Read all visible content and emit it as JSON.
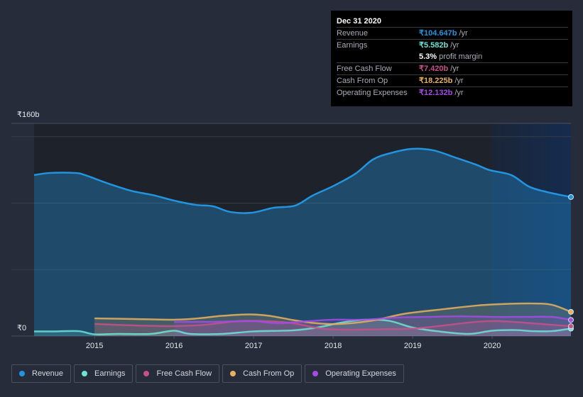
{
  "tooltip": {
    "date": "Dec 31 2020",
    "rows": [
      {
        "label": "Revenue",
        "value": "₹104.647b",
        "unit": "/yr",
        "color": "#2394df"
      },
      {
        "label": "Earnings",
        "value": "₹5.582b",
        "unit": "/yr",
        "color": "#6ce5d5"
      },
      {
        "label": "",
        "value": "5.3%",
        "unit": "profit margin",
        "color": "#ffffff"
      },
      {
        "label": "Free Cash Flow",
        "value": "₹7.420b",
        "unit": "/yr",
        "color": "#c8508a"
      },
      {
        "label": "Cash From Op",
        "value": "₹18.225b",
        "unit": "/yr",
        "color": "#e9b15e"
      },
      {
        "label": "Operating Expenses",
        "value": "₹12.132b",
        "unit": "/yr",
        "color": "#a54be6"
      }
    ]
  },
  "legend": [
    {
      "label": "Revenue",
      "color": "#2394df"
    },
    {
      "label": "Earnings",
      "color": "#6ce5d5"
    },
    {
      "label": "Free Cash Flow",
      "color": "#c8508a"
    },
    {
      "label": "Cash From Op",
      "color": "#e9b15e"
    },
    {
      "label": "Operating Expenses",
      "color": "#a54be6"
    }
  ],
  "chart_data": {
    "type": "area",
    "title": "",
    "xlabel": "",
    "ylabel": "",
    "currency": "₹",
    "y_tick_labels": [
      "₹0",
      "₹160b"
    ],
    "ylim": [
      0,
      160
    ],
    "y_unit": "billions INR",
    "xlim": [
      2014.24,
      2020.99
    ],
    "x_tick_labels": [
      "2015",
      "2016",
      "2017",
      "2018",
      "2019",
      "2020"
    ],
    "x_ticks": [
      2015,
      2016,
      2017,
      2018,
      2019,
      2020
    ],
    "gridlines": [
      50,
      100,
      150
    ],
    "highlight_region_from": 2020.0,
    "series": [
      {
        "name": "Revenue",
        "color": "#2394df",
        "filled": true,
        "points": [
          [
            2014.24,
            121.1
          ],
          [
            2014.44,
            122.7
          ],
          [
            2014.75,
            122.7
          ],
          [
            2014.88,
            121.1
          ],
          [
            2015.15,
            115.2
          ],
          [
            2015.46,
            109.3
          ],
          [
            2015.73,
            106.1
          ],
          [
            2016.0,
            101.9
          ],
          [
            2016.27,
            98.7
          ],
          [
            2016.49,
            97.6
          ],
          [
            2016.71,
            93.3
          ],
          [
            2016.98,
            92.8
          ],
          [
            2017.25,
            96.5
          ],
          [
            2017.52,
            98.1
          ],
          [
            2017.74,
            105.6
          ],
          [
            2018.01,
            113.1
          ],
          [
            2018.28,
            122.1
          ],
          [
            2018.5,
            132.8
          ],
          [
            2018.72,
            137.6
          ],
          [
            2018.99,
            140.8
          ],
          [
            2019.26,
            139.7
          ],
          [
            2019.53,
            134.4
          ],
          [
            2019.79,
            129.1
          ],
          [
            2019.97,
            124.8
          ],
          [
            2020.24,
            121.1
          ],
          [
            2020.46,
            112.5
          ],
          [
            2020.69,
            108.3
          ],
          [
            2020.99,
            104.6
          ]
        ]
      },
      {
        "name": "Earnings",
        "color": "#6ce5d5",
        "filled": true,
        "points": [
          [
            2014.24,
            3.5
          ],
          [
            2014.5,
            3.5
          ],
          [
            2014.8,
            3.7
          ],
          [
            2015.0,
            1.3
          ],
          [
            2015.3,
            1.6
          ],
          [
            2015.7,
            1.6
          ],
          [
            2016.0,
            4.0
          ],
          [
            2016.2,
            1.6
          ],
          [
            2016.6,
            1.6
          ],
          [
            2017.0,
            3.5
          ],
          [
            2017.5,
            4.3
          ],
          [
            2017.8,
            6.4
          ],
          [
            2018.1,
            10.1
          ],
          [
            2018.4,
            12.3
          ],
          [
            2018.7,
            11.5
          ],
          [
            2019.0,
            6.4
          ],
          [
            2019.3,
            3.7
          ],
          [
            2019.7,
            1.6
          ],
          [
            2020.0,
            4.0
          ],
          [
            2020.3,
            4.5
          ],
          [
            2020.5,
            3.7
          ],
          [
            2020.75,
            3.7
          ],
          [
            2020.99,
            5.6
          ]
        ]
      },
      {
        "name": "Free Cash Flow",
        "color": "#c8508a",
        "filled": true,
        "points": [
          [
            2015.0,
            9.1
          ],
          [
            2015.5,
            8.0
          ],
          [
            2016.0,
            7.5
          ],
          [
            2016.4,
            8.5
          ],
          [
            2016.8,
            11.2
          ],
          [
            2017.15,
            11.2
          ],
          [
            2017.5,
            9.6
          ],
          [
            2017.85,
            5.6
          ],
          [
            2018.2,
            4.8
          ],
          [
            2018.6,
            5.1
          ],
          [
            2019.0,
            5.6
          ],
          [
            2019.4,
            8.0
          ],
          [
            2019.8,
            10.7
          ],
          [
            2020.1,
            11.2
          ],
          [
            2020.5,
            9.6
          ],
          [
            2020.99,
            7.4
          ]
        ]
      },
      {
        "name": "Cash From Op",
        "color": "#e9b15e",
        "filled": true,
        "points": [
          [
            2015.0,
            13.3
          ],
          [
            2015.5,
            12.8
          ],
          [
            2016.0,
            12.3
          ],
          [
            2016.3,
            13.3
          ],
          [
            2016.6,
            15.2
          ],
          [
            2016.95,
            16.3
          ],
          [
            2017.2,
            15.2
          ],
          [
            2017.5,
            12.0
          ],
          [
            2017.8,
            9.6
          ],
          [
            2018.1,
            9.1
          ],
          [
            2018.5,
            11.7
          ],
          [
            2018.9,
            16.8
          ],
          [
            2019.4,
            20.3
          ],
          [
            2019.8,
            22.9
          ],
          [
            2020.1,
            24.0
          ],
          [
            2020.5,
            24.5
          ],
          [
            2020.75,
            23.5
          ],
          [
            2020.99,
            18.2
          ]
        ]
      },
      {
        "name": "Operating Expenses",
        "color": "#a54be6",
        "filled": true,
        "points": [
          [
            2016.0,
            10.7
          ],
          [
            2016.5,
            10.7
          ],
          [
            2017.0,
            11.2
          ],
          [
            2017.3,
            9.6
          ],
          [
            2017.7,
            11.2
          ],
          [
            2018.0,
            12.3
          ],
          [
            2018.4,
            12.3
          ],
          [
            2018.8,
            13.9
          ],
          [
            2019.2,
            14.4
          ],
          [
            2019.6,
            14.9
          ],
          [
            2020.0,
            14.4
          ],
          [
            2020.4,
            14.4
          ],
          [
            2020.75,
            14.4
          ],
          [
            2020.99,
            12.1
          ]
        ]
      }
    ]
  }
}
